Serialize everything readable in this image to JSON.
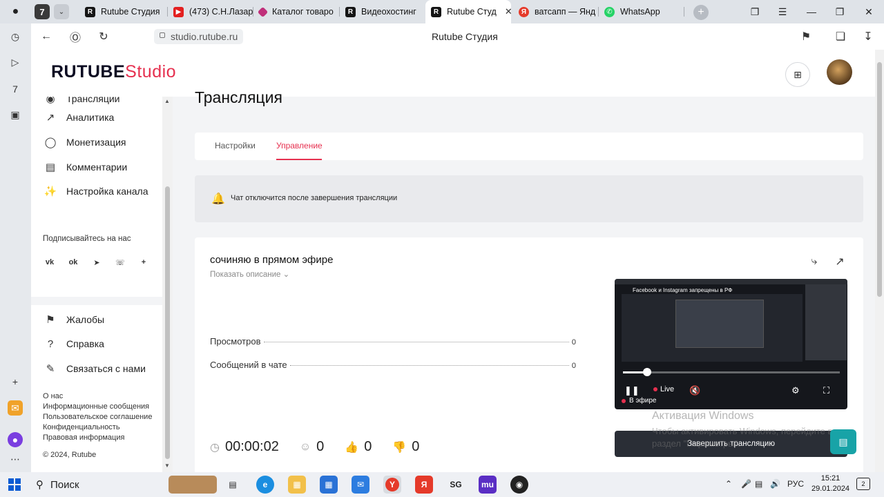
{
  "browser": {
    "tab_counter": "7",
    "tabs": [
      {
        "title": "Rutube Студия",
        "icon": "rutube-icon"
      },
      {
        "title": "(473) С.Н.Лазар",
        "icon": "youtube-icon"
      },
      {
        "title": "Каталог товаро",
        "icon": "catalog-icon"
      },
      {
        "title": "Видеохостинг",
        "icon": "rutube-icon"
      },
      {
        "title": "Rutube Студ",
        "icon": "rutube-icon",
        "active": true
      },
      {
        "title": "ватсапп — Янд",
        "icon": "yandex-icon"
      },
      {
        "title": "WhatsApp",
        "icon": "whatsapp-icon"
      }
    ],
    "url": "studio.rutube.ru",
    "page_title": "Rutube Студия"
  },
  "app": {
    "logo_main": "RUTUBE",
    "logo_accent": "Studio",
    "accent_color": "#e6304f"
  },
  "sidebar": {
    "partial_item": "Трансляции",
    "items": [
      {
        "label": "Аналитика",
        "icon": "chart-icon"
      },
      {
        "label": "Монетизация",
        "icon": "coin-icon"
      },
      {
        "label": "Комментарии",
        "icon": "comment-icon"
      },
      {
        "label": "Настройка канала",
        "icon": "wand-icon"
      }
    ],
    "subscribe_label": "Подписывайтесь на нас",
    "socials": [
      "VK",
      "OK",
      "Telegram",
      "Viber",
      "more"
    ],
    "bottom_items": [
      {
        "label": "Жалобы",
        "icon": "flag-icon"
      },
      {
        "label": "Справка",
        "icon": "help-icon"
      },
      {
        "label": "Связаться с нами",
        "icon": "edit-icon"
      }
    ],
    "footer_links": [
      "О нас",
      "Информационные сообщения",
      "Пользовательское соглашение",
      "Конфиденциальность",
      "Правовая информация"
    ],
    "copyright": "© 2024, Rutube"
  },
  "main": {
    "title": "Трансляция",
    "tabs": [
      {
        "label": "Настройки",
        "active": false
      },
      {
        "label": "Управление",
        "active": true
      }
    ],
    "notice": "Чат отключится после завершения трансляции",
    "stream": {
      "name": "сочиняю в прямом эфире",
      "show_description": "Показать описание",
      "stats": [
        {
          "label": "Просмотров",
          "value": "0"
        },
        {
          "label": "Сообщений в чате",
          "value": "0"
        }
      ],
      "timer": "00:00:02",
      "viewers": "0",
      "likes": "0",
      "dislikes": "0"
    },
    "player": {
      "caption": "Facebook и Instagram запрещены в РФ",
      "live_label": "Live",
      "on_air_label": "В эфире",
      "progress": 0.11
    },
    "end_button": "Завершить трансляцию",
    "windows_activation": {
      "title": "Активация Windows",
      "text": "Чтобы активировать Windows, перейдите в раздел \"Параметры\"."
    }
  },
  "taskbar": {
    "search_label": "Поиск",
    "language": "РУС",
    "time": "15:21",
    "date": "29.01.2024"
  }
}
